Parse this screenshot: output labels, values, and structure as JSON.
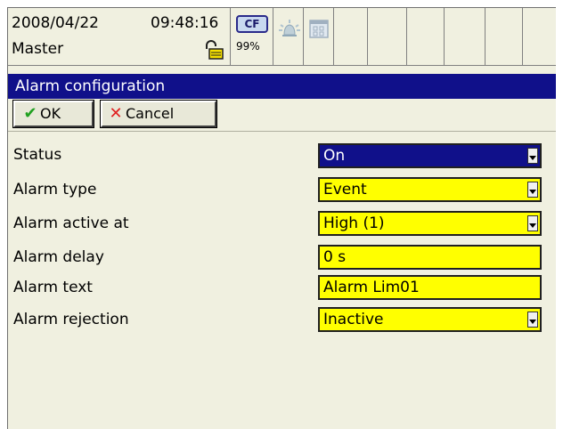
{
  "status_bar": {
    "date": "2008/04/22",
    "time": "09:48:16",
    "user": "Master",
    "cf_label": "CF",
    "cf_percent": "99%"
  },
  "dialog": {
    "title": "Alarm configuration",
    "ok_label": "OK",
    "cancel_label": "Cancel",
    "rows": [
      {
        "label": "Status",
        "value": "On",
        "type": "dropdown",
        "selected": true
      },
      {
        "label": "Alarm type",
        "value": "Event",
        "type": "dropdown"
      },
      {
        "label": "Alarm active at",
        "value": "High (1)",
        "type": "dropdown"
      },
      {
        "label": "Alarm delay",
        "value": "0 s",
        "type": "text"
      },
      {
        "label": "Alarm text",
        "value": "Alarm Lim01",
        "type": "text"
      },
      {
        "label": "Alarm rejection",
        "value": "Inactive",
        "type": "dropdown"
      }
    ]
  },
  "colors": {
    "title_bar": "#10108a",
    "field_background": "#ffff00",
    "panel_background": "#f0f0e0"
  }
}
